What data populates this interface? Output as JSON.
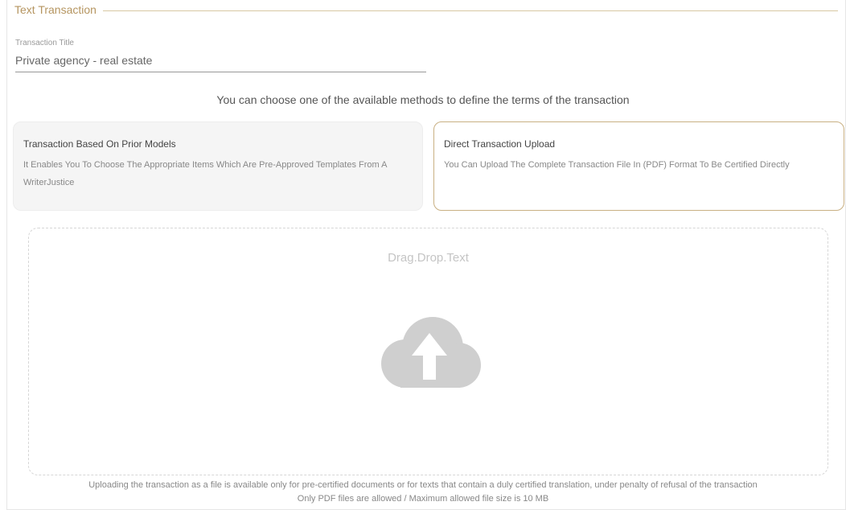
{
  "section": {
    "legend": "Text Transaction"
  },
  "title_field": {
    "label": "Transaction Title",
    "value": "Private agency - real estate"
  },
  "instruction": "You can choose one of the available methods to define the terms of the transaction",
  "options": [
    {
      "title": "Transaction Based On Prior Models",
      "description": "It Enables You To Choose The Appropriate Items Which Are Pre-Approved Templates From A WriterJustice",
      "selected": false
    },
    {
      "title": "Direct Transaction Upload",
      "description": "You Can Upload The Complete Transaction File In (PDF) Format To Be Certified Directly",
      "selected": true
    }
  ],
  "dropzone": {
    "text": "Drag.Drop.Text",
    "icon": "cloud-upload-icon"
  },
  "notes": {
    "line1": "Uploading the transaction as a file is available only for pre-certified documents or for texts that contain a duly certified translation, under penalty of refusal of the transaction",
    "line2": "Only PDF files are allowed / Maximum allowed file size is 10 MB"
  },
  "colors": {
    "accent": "#b59560",
    "selected_border": "#c9b083",
    "icon": "#cfcfcf"
  }
}
